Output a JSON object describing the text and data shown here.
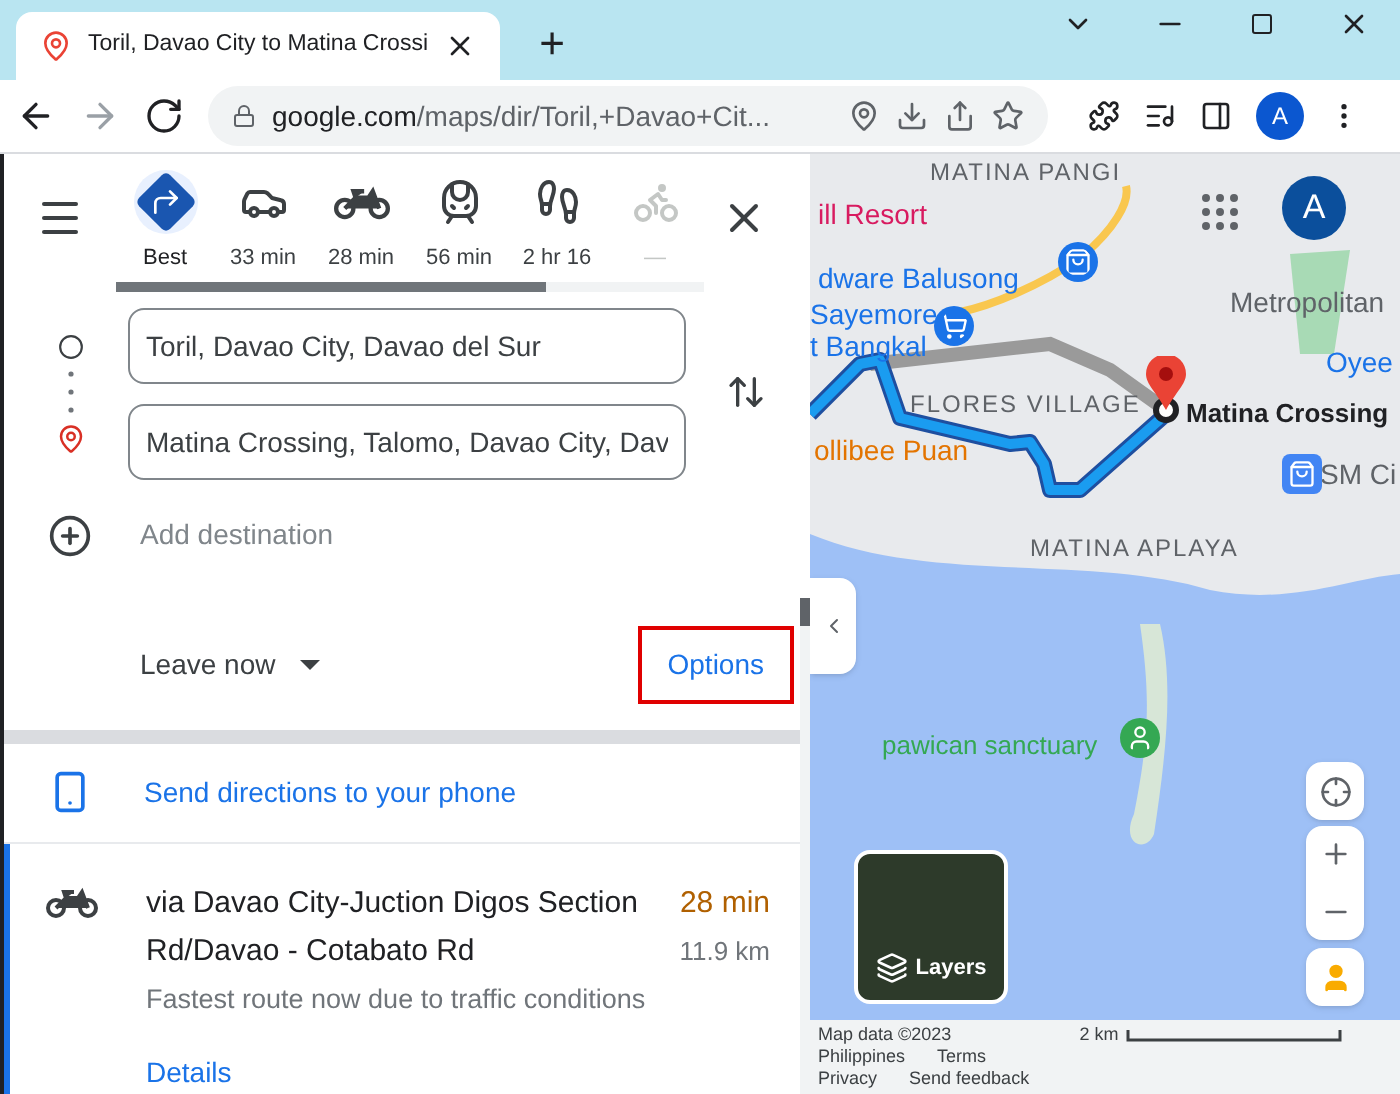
{
  "browser": {
    "tab_title": "Toril, Davao City to Matina Crossi",
    "new_tab": "+",
    "url_host": "google.com",
    "url_path": "/maps/dir/Toril,+Davao+Cit...",
    "profile": "A"
  },
  "modes": [
    {
      "kind": "best",
      "label": "Best",
      "selected": true,
      "disabled": false
    },
    {
      "kind": "car",
      "label": "33 min",
      "selected": false,
      "disabled": false
    },
    {
      "kind": "moto",
      "label": "28 min",
      "selected": false,
      "disabled": false
    },
    {
      "kind": "transit",
      "label": "56 min",
      "selected": false,
      "disabled": false
    },
    {
      "kind": "walk",
      "label": "2 hr 16",
      "selected": false,
      "disabled": false
    },
    {
      "kind": "bike",
      "label": "—",
      "selected": false,
      "disabled": true
    }
  ],
  "loading": {
    "level": 0.73
  },
  "origin": {
    "value": "Toril, Davao City, Davao del Sur"
  },
  "destination": {
    "value": "Matina Crossing, Talomo, Davao City, Dav"
  },
  "add_destination": {
    "placeholder": "Add destination"
  },
  "leave_now": "Leave now",
  "options": "Options",
  "send_directions": "Send directions to your phone",
  "route": {
    "title": "via Davao City-Juction Digos Section Rd/Davao - Cotabato Rd",
    "time": "28 min",
    "distance": "11.9 km",
    "note": "Fastest route now due to traffic conditions",
    "details": "Details"
  },
  "map": {
    "profile": "A",
    "labels": [
      {
        "kind": "area",
        "text": "MATINA PANGI"
      },
      {
        "kind": "pink",
        "text": "ill Resort"
      },
      {
        "kind": "blue",
        "text": "dware Balusong"
      },
      {
        "kind": "blue",
        "text": "Sayemore"
      },
      {
        "kind": "blue",
        "text": "t Bangkal"
      },
      {
        "kind": "area",
        "text": "FLORES VILLAGE"
      },
      {
        "kind": "orange",
        "text": "ollibee Puan"
      },
      {
        "kind": "grey",
        "text": "Metropolitan"
      },
      {
        "kind": "blue",
        "text": "Oyee"
      },
      {
        "kind": "bold",
        "text": "Matina Crossing"
      },
      {
        "kind": "grey",
        "text": "SM Ci"
      },
      {
        "kind": "area",
        "text": "MATINA APLAYA"
      },
      {
        "kind": "green",
        "text": "pawican sanctuary"
      }
    ],
    "layers": "Layers",
    "footer": {
      "map_data": "Map data ©2023",
      "scale": "2 km",
      "country": "Philippines",
      "terms": "Terms",
      "privacy": "Privacy",
      "feedback": "Send feedback"
    }
  }
}
